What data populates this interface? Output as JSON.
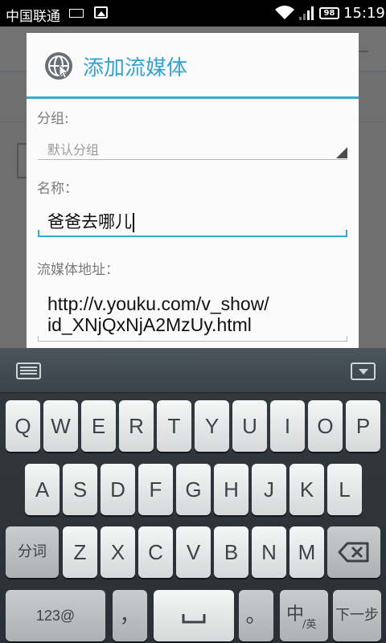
{
  "status_bar": {
    "carrier": "中国联通",
    "battery": "98",
    "time": "15:19",
    "icons": [
      "keyboard-icon",
      "image-icon",
      "wifi-icon",
      "signal-icon",
      "battery-icon"
    ]
  },
  "dialog": {
    "title": "添加流媒体",
    "icon": "globe-cursor-icon",
    "accent_color": "#34a9d3",
    "group_label": "分组:",
    "group_value": "默认分组",
    "name_label": "名称：",
    "name_value": "爸爸去哪儿",
    "url_label": "流媒体地址：",
    "url_line1": "http://v.youku.com/v_show/",
    "url_line2": "id_XNjQxNjA2MzUy.html"
  },
  "keyboard": {
    "row1": [
      "Q",
      "W",
      "E",
      "R",
      "T",
      "Y",
      "U",
      "I",
      "O",
      "P"
    ],
    "row2": [
      "A",
      "S",
      "D",
      "F",
      "G",
      "H",
      "J",
      "K",
      "L"
    ],
    "row3": [
      "Z",
      "X",
      "C",
      "V",
      "B",
      "N",
      "M"
    ],
    "fenci": "分词",
    "num": "123@",
    "comma": "，",
    "period": "。",
    "lang_main": "中",
    "lang_sub": "/英",
    "next": "下一步"
  }
}
